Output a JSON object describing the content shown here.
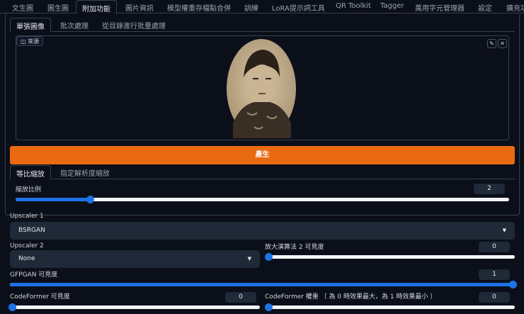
{
  "top_tabs": [
    "文生圖",
    "圖生圖",
    "附加功能",
    "圖片資訊",
    "模型權重存檔點合併",
    "訓練",
    "LoRA提示詞工具",
    "QR Toolkit",
    "Tagger",
    "萬用字元管理器",
    "設定",
    "擴充功"
  ],
  "sub_tabs": [
    "單張圖像",
    "批次處理",
    "從目錄進行批量處理"
  ],
  "source_label": "來源",
  "generate_label": "產生",
  "resize_tabs": [
    "等比縮放",
    "指定解析度縮放"
  ],
  "scale": {
    "label": "縮放比例",
    "value": "2",
    "fraction": 0.15
  },
  "upscaler1": {
    "label": "Upscaler 1",
    "value": "BSRGAN"
  },
  "upscaler2": {
    "label": "Upscaler 2",
    "value": "None"
  },
  "upscaler2_visibility": {
    "label": "放大演算法 2 可見度",
    "value": "0",
    "fraction": 0
  },
  "gfpgan": {
    "label": "GFPGAN 可見度",
    "value": "1",
    "fraction": 1
  },
  "codeformer_visibility": {
    "label": "CodeFormer 可見度",
    "value": "0",
    "fraction": 0
  },
  "codeformer_weight": {
    "label": "CodeFormer 權重 （ 為 0 時效果最大，為 1 時效果最小 ）",
    "value": "0",
    "fraction": 0
  },
  "colors": {
    "accent": "#1d72e8",
    "generate": "#ea6a12"
  }
}
